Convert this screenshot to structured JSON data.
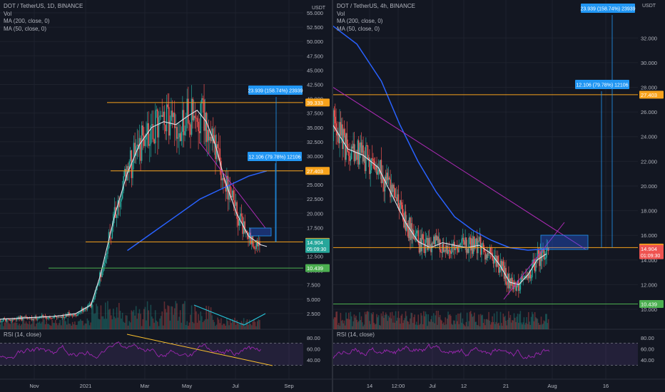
{
  "colors": {
    "background": "#131722",
    "candle_up": "#26a69a",
    "candle_down": "#ef5350",
    "ma200": "#2962ff",
    "ma50": "#e0e3eb",
    "level_line": "#f7a21b",
    "support_line": "#4caf50",
    "trendline": "#b02bb8",
    "rsi_line": "#9c27b0",
    "rsi_trend": "#fbc02d",
    "volume_trend": "#26c6da",
    "projection": "#2196f3"
  },
  "left_chart": {
    "header": {
      "symbol": "DOT / TetherUS, 1D, BINANCE",
      "vol": "Vol",
      "ma200": "MA (200, close, 0)",
      "ma50": "MA (50, close, 0)"
    },
    "rsi_label": "RSI (14, close)",
    "currency": "USDT"
  },
  "right_chart": {
    "header": {
      "symbol": "DOT / TetherUS, 4h, BINANCE",
      "vol": "Vol",
      "ma200": "MA (200, close, 0)",
      "ma50": "MA (50, close, 0)"
    },
    "rsi_label": "RSI (14, close)",
    "currency": "USDT"
  },
  "chart_data": [
    {
      "type": "candlestick",
      "symbol": "DOT / TetherUS",
      "interval": "1D",
      "exchange": "BINANCE",
      "x_ticks": [
        "Nov",
        "2021",
        "Mar",
        "May",
        "Jul",
        "Sep"
      ],
      "y_ticks": [
        2.5,
        5.0,
        7.5,
        10.0,
        12.5,
        15.0,
        17.5,
        20.0,
        22.5,
        25.0,
        27.5,
        30.0,
        32.5,
        35.0,
        37.5,
        40.0,
        42.5,
        45.0,
        47.5,
        50.0,
        52.5,
        55.0
      ],
      "y_tick_labels": [
        "2.500",
        "5.000",
        "7.500",
        "10.000",
        "12.500",
        "15.000",
        "17.500",
        "20.000",
        "22.500",
        "25.000",
        "27.500",
        "30.000",
        "32.500",
        "35.000",
        "37.500",
        "40.000",
        "42.500",
        "45.000",
        "47.500",
        "50.000",
        "52.500",
        "55.000"
      ],
      "ylim": [
        0,
        56
      ],
      "series": [
        {
          "name": "MA (200, close, 0)",
          "x": [
            0.42,
            0.5,
            0.58,
            0.66,
            0.74,
            0.82,
            0.88
          ],
          "y": [
            13.5,
            16.5,
            19.5,
            22.5,
            24.5,
            26.5,
            27.4
          ]
        },
        {
          "name": "MA (50, close, 0)",
          "x": [
            0.0,
            0.1,
            0.18,
            0.25,
            0.3,
            0.33,
            0.38,
            0.42,
            0.46,
            0.5,
            0.54,
            0.58,
            0.62,
            0.65,
            0.68,
            0.71,
            0.74,
            0.78,
            0.82,
            0.86,
            0.88
          ],
          "y": [
            1.5,
            1.8,
            2.0,
            2.5,
            4.0,
            9.0,
            20.0,
            27.0,
            32.0,
            35.0,
            36.0,
            35.5,
            37.0,
            38.0,
            36.0,
            32.0,
            26.0,
            20.0,
            16.0,
            14.5,
            14.2
          ]
        }
      ],
      "price_labels": [
        {
          "label": "39.333",
          "value": 39.333,
          "color": "#f7a21b"
        },
        {
          "label": "27.403",
          "value": 27.403,
          "color": "#f7a21b"
        },
        {
          "label": "15.004",
          "value": 15.004,
          "color": "#f7a21b"
        },
        {
          "label": "14.904",
          "value": 14.904,
          "color": "#26a69a",
          "sub": "05:09:30"
        },
        {
          "label": "10.439",
          "value": 10.439,
          "color": "#4caf50"
        }
      ],
      "annotations": [
        "23.939 (158.74%) 23939",
        "12.106 (79.78%) 12106"
      ],
      "rsi": {
        "label": "RSI (14, close)",
        "ticks": [
          40.0,
          60.0,
          80.0
        ],
        "tick_labels": [
          "40.00",
          "60.00",
          "80.00"
        ],
        "upper": 70,
        "lower": 30
      }
    },
    {
      "type": "candlestick",
      "symbol": "DOT / TetherUS",
      "interval": "4h",
      "exchange": "BINANCE",
      "x_ticks": [
        "14",
        "12:00",
        "Jul",
        "12",
        "21",
        "Aug",
        "16"
      ],
      "y_ticks": [
        10.0,
        12.0,
        14.0,
        16.0,
        18.0,
        20.0,
        22.0,
        24.0,
        26.0,
        28.0,
        30.0,
        32.0
      ],
      "y_tick_labels": [
        "10.000",
        "12.000",
        "14.000",
        "16.000",
        "18.000",
        "20.000",
        "22.000",
        "24.000",
        "26.000",
        "28.000",
        "30.000",
        "32.000"
      ],
      "ylim": [
        8.5,
        34.5
      ],
      "series": [
        {
          "name": "MA (200, close, 0)",
          "x": [
            0.0,
            0.08,
            0.16,
            0.22,
            0.28,
            0.34,
            0.4,
            0.46,
            0.52,
            0.58,
            0.64,
            0.7
          ],
          "y": [
            33.0,
            31.5,
            28.5,
            25.0,
            22.0,
            19.5,
            17.5,
            16.4,
            15.6,
            15.0,
            14.8,
            14.9
          ]
        },
        {
          "name": "MA (50, close, 0)",
          "x": [
            0.0,
            0.05,
            0.1,
            0.15,
            0.2,
            0.24,
            0.28,
            0.32,
            0.36,
            0.4,
            0.44,
            0.48,
            0.52,
            0.55,
            0.58,
            0.61,
            0.64,
            0.67,
            0.7
          ],
          "y": [
            25.0,
            23.0,
            22.5,
            21.5,
            19.0,
            17.0,
            15.5,
            15.0,
            15.4,
            15.2,
            15.0,
            15.2,
            14.5,
            13.5,
            12.2,
            12.0,
            12.8,
            14.0,
            14.5
          ]
        }
      ],
      "price_labels": [
        {
          "label": "27.403",
          "value": 27.403,
          "color": "#f7a21b"
        },
        {
          "label": "15.004",
          "value": 15.004,
          "color": "#f7a21b"
        },
        {
          "label": "14.904",
          "value": 14.904,
          "color": "#ef5350",
          "sub": "01:09:30"
        },
        {
          "label": "10.439",
          "value": 10.439,
          "color": "#4caf50"
        }
      ],
      "annotations": [
        "23.939 (158.74%) 23939",
        "12.106 (79.78%) 12106"
      ],
      "rsi": {
        "label": "RSI (14, close)",
        "ticks": [
          40.0,
          60.0,
          80.0
        ],
        "tick_labels": [
          "40.00",
          "60.00",
          "80.00"
        ],
        "upper": 70,
        "lower": 30
      }
    }
  ]
}
